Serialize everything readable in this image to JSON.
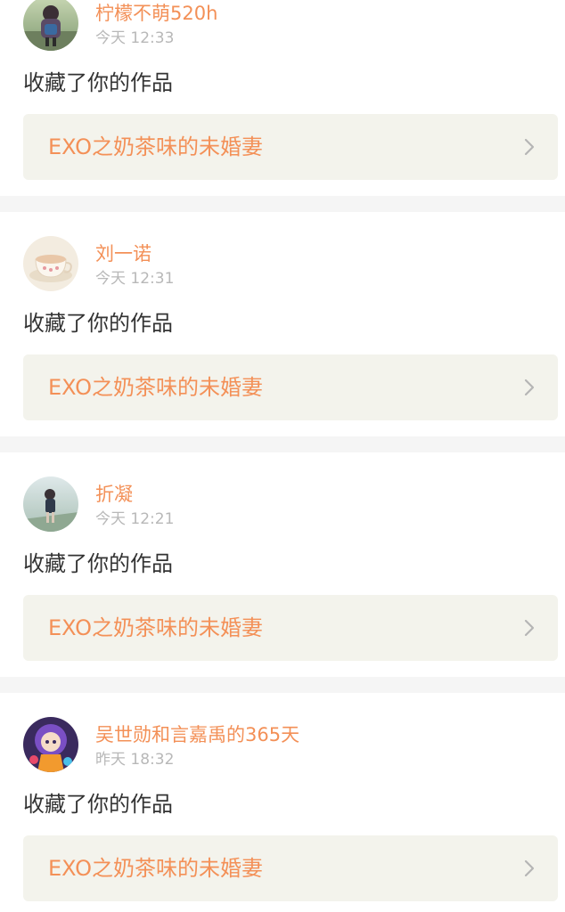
{
  "theme": {
    "accent": "#f39057",
    "divider": "#f5f5f5",
    "link_background": "#f3f3ec",
    "chevron": "#b5b5b5"
  },
  "notifications": [
    {
      "username": "柠檬不萌520h",
      "time": "今天 12:33",
      "action": "收藏了你的作品",
      "work_title": "EXO之奶茶味的未婚妻",
      "avatar_icon": "girl-with-backpack-avatar"
    },
    {
      "username": "刘一诺",
      "time": "今天 12:31",
      "action": "收藏了你的作品",
      "work_title": "EXO之奶茶味的未婚妻",
      "avatar_icon": "teacup-avatar"
    },
    {
      "username": "折凝",
      "time": "今天 12:21",
      "action": "收藏了你的作品",
      "work_title": "EXO之奶茶味的未婚妻",
      "avatar_icon": "girl-on-path-avatar"
    },
    {
      "username": "吴世勋和言嘉禹的365天",
      "time": "昨天 18:32",
      "action": "收藏了你的作品",
      "work_title": "EXO之奶茶味的未婚妻",
      "avatar_icon": "anime-girl-avatar"
    }
  ]
}
